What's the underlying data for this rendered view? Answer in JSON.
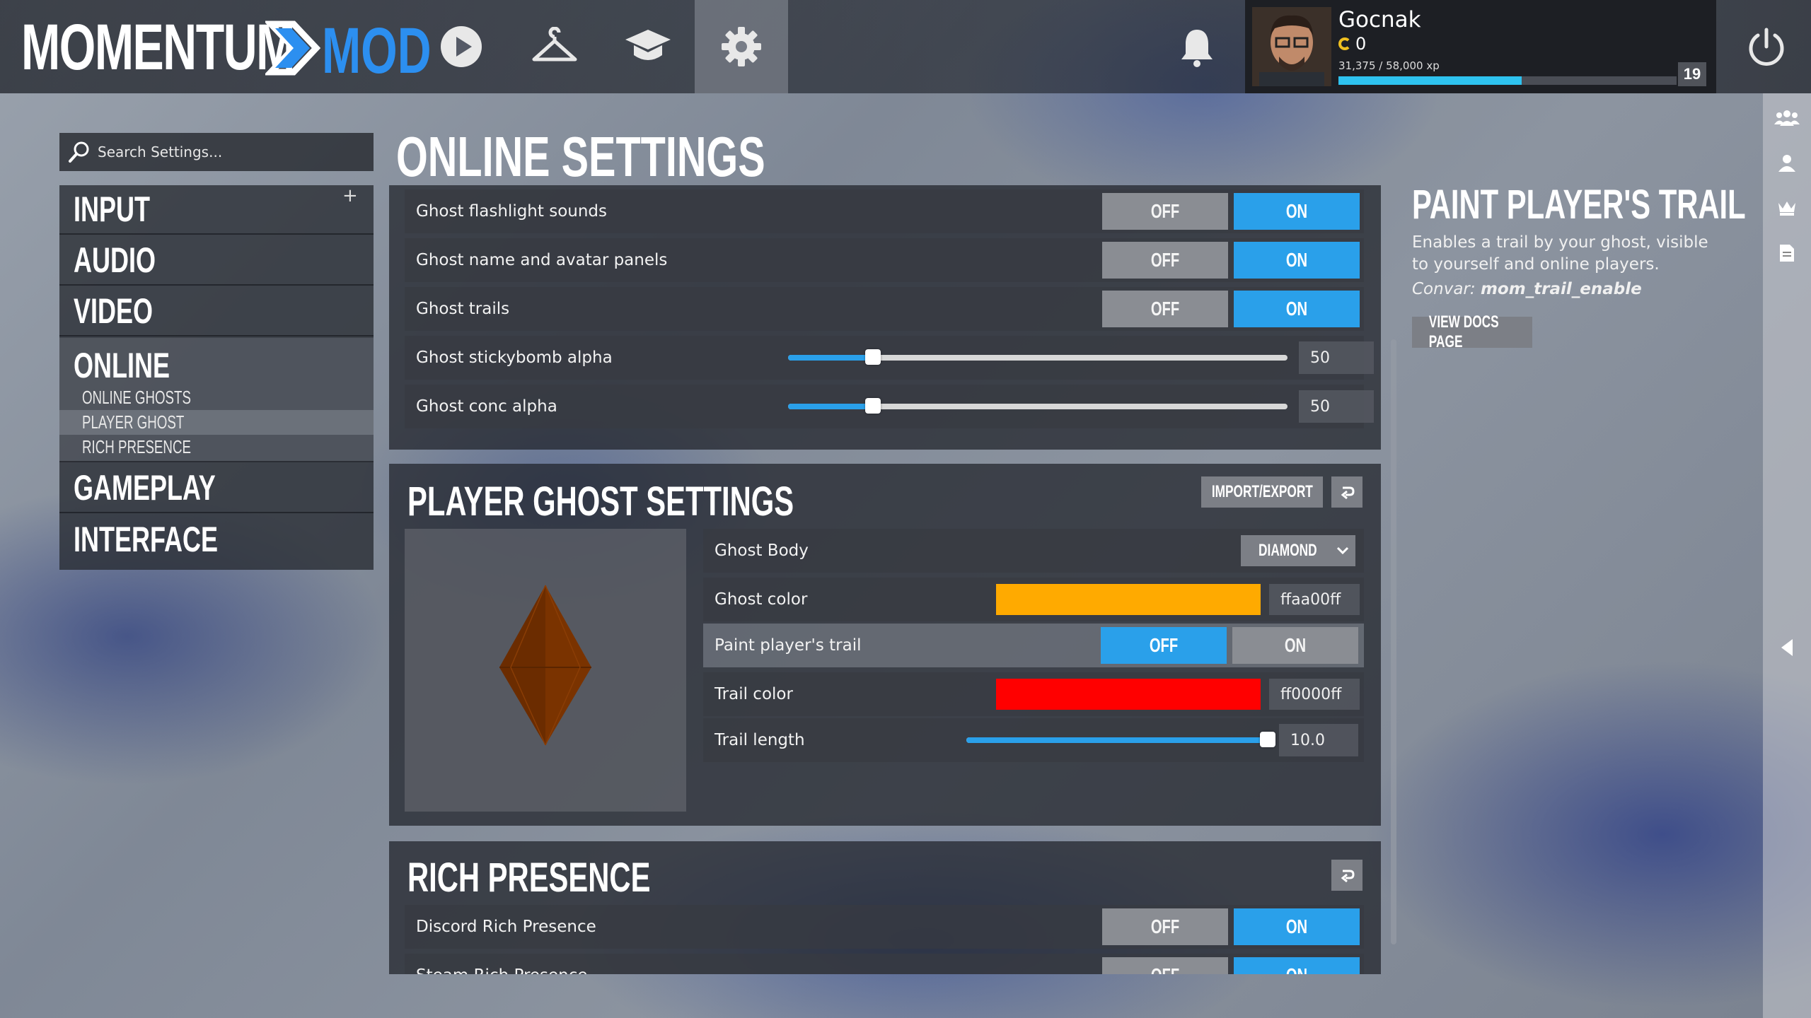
{
  "topbar": {
    "logo_left": "MOMENTUM",
    "logo_right": "MOD",
    "nav": [
      "play-icon",
      "hanger-icon",
      "graduation-cap-icon",
      "gear-icon"
    ],
    "user": {
      "name": "Gocnak",
      "coins": "0",
      "xp_text": "31,375 / 58,000 xp",
      "xp_fraction": 0.541,
      "level": "19"
    }
  },
  "search": {
    "placeholder": "Search Settings..."
  },
  "sidebar": {
    "categories": [
      "INPUT",
      "AUDIO",
      "VIDEO",
      "ONLINE",
      "GAMEPLAY",
      "INTERFACE"
    ],
    "selected": "ONLINE",
    "subitems": [
      "ONLINE GHOSTS",
      "PLAYER GHOST",
      "RICH PRESENCE"
    ],
    "selected_sub": "PLAYER GHOST",
    "plus": "+"
  },
  "page": {
    "title": "ONLINE SETTINGS"
  },
  "toggle": {
    "off": "OFF",
    "on": "ON"
  },
  "online_ghosts": {
    "rows": [
      {
        "label": "Ghost flashlight sounds",
        "value": "ON"
      },
      {
        "label": "Ghost name and avatar panels",
        "value": "ON"
      },
      {
        "label": "Ghost trails",
        "value": "ON"
      },
      {
        "label": "Ghost stickybomb alpha",
        "value": "50",
        "fraction": 0.17
      },
      {
        "label": "Ghost conc alpha",
        "value": "50",
        "fraction": 0.17
      }
    ]
  },
  "player_ghost": {
    "title": "PLAYER GHOST SETTINGS",
    "import_export": "IMPORT/EXPORT",
    "ghost_body": {
      "label": "Ghost Body",
      "value": "DIAMOND"
    },
    "ghost_color": {
      "label": "Ghost color",
      "value": "ffaa00ff",
      "color": "#ffaa00"
    },
    "paint_trail": {
      "label": "Paint player's trail",
      "value": "OFF"
    },
    "trail_color": {
      "label": "Trail color",
      "value": "ff0000ff",
      "color": "#ff0000"
    },
    "trail_length": {
      "label": "Trail length",
      "value": "10.0",
      "fraction": 1.0
    }
  },
  "rich_presence": {
    "title": "RICH PRESENCE",
    "rows": [
      {
        "label": "Discord Rich Presence",
        "value": "ON"
      },
      {
        "label": "Steam Rich Presence",
        "value": "ON"
      }
    ]
  },
  "info": {
    "title": "PAINT PLAYER'S TRAIL",
    "description": "Enables a trail by your ghost, visible to yourself and online players.",
    "convar_label": "Convar:",
    "convar": "mom_trail_enable",
    "docs_button": "VIEW DOCS PAGE"
  },
  "colors": {
    "accent": "#2aa0ea",
    "logo_blue": "#2c8ff0",
    "xp": "#2ec2ef"
  }
}
